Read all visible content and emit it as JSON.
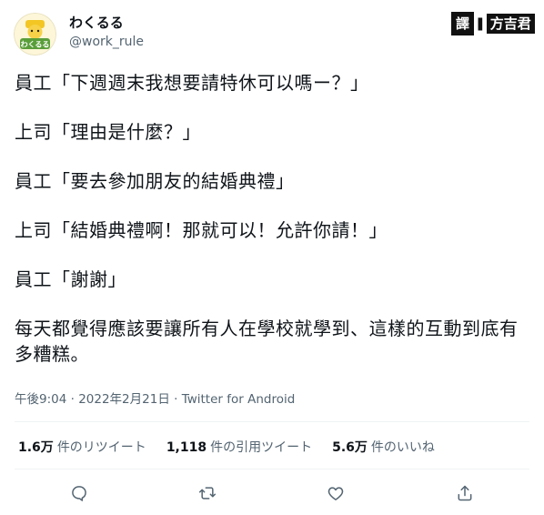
{
  "account": {
    "display_name": "わくるる",
    "handle": "@work_rule",
    "avatar_text": "わくるる"
  },
  "watermark": {
    "left_box": "譯",
    "separator": "❚",
    "right_box": "方吉君"
  },
  "tweet": {
    "lines": [
      "員工「下週週末我想要請特休可以嗎ー？」",
      "上司「理由是什麼？」",
      "員工「要去參加朋友的結婚典禮」",
      "上司「結婚典禮啊！那就可以！允許你請！」",
      "員工「謝謝」",
      "每天都覺得應該要讓所有人在學校就學到、這樣的互動到底有多糟糕。"
    ]
  },
  "meta": {
    "time": "午後9:04",
    "separator": " · ",
    "date": "2022年2月21日",
    "source": "Twitter for Android"
  },
  "stats": {
    "retweets_count": "1.6万",
    "retweets_label": "件のリツイート",
    "quotes_count": "1,118",
    "quotes_label": "件の引用ツイート",
    "likes_count": "5.6万",
    "likes_label": "件のいいね"
  },
  "icons": {
    "reply": "reply-icon",
    "retweet": "retweet-icon",
    "like": "heart-icon",
    "share": "share-icon"
  },
  "colors": {
    "text": "#0f1419",
    "secondary": "#536471",
    "divider": "#eff3f4"
  }
}
